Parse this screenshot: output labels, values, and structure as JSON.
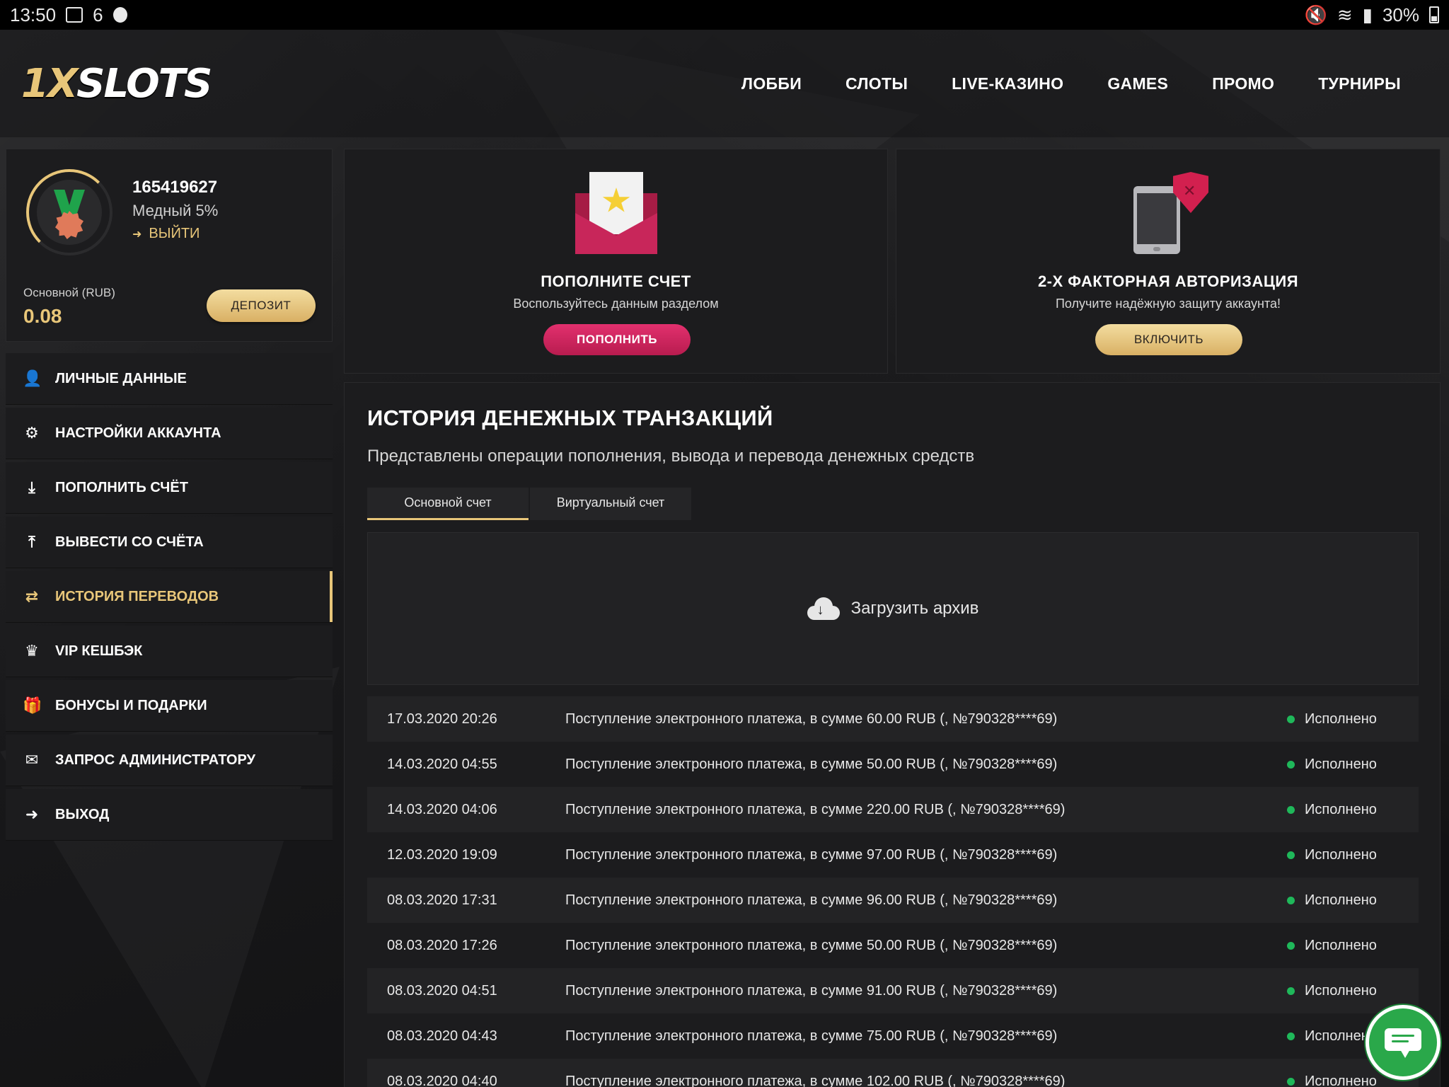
{
  "statusbar": {
    "time": "13:50",
    "notif_count": "6",
    "battery": "30%"
  },
  "header": {
    "logo_accent": "1X",
    "logo_main": "SLOTS",
    "nav": [
      "ЛОББИ",
      "СЛОТЫ",
      "LIVE-КАЗИНО",
      "GAMES",
      "ПРОМО",
      "ТУРНИРЫ"
    ]
  },
  "profile": {
    "user_id": "165419627",
    "level": "Медный 5%",
    "logout_label": "ВЫЙТИ",
    "balance_label": "Основной (RUB)",
    "balance_value": "0.08",
    "deposit_button": "ДЕПОЗИТ"
  },
  "menu": [
    {
      "label": "ЛИЧНЫЕ ДАННЫЕ",
      "icon": "user-plus-icon"
    },
    {
      "label": "НАСТРОЙКИ АККАУНТА",
      "icon": "gears-icon"
    },
    {
      "label": "ПОПОЛНИТЬ СЧЁТ",
      "icon": "download-icon"
    },
    {
      "label": "ВЫВЕСТИ СО СЧЁТА",
      "icon": "upload-icon"
    },
    {
      "label": "ИСТОРИЯ ПЕРЕВОДОВ",
      "icon": "transfer-arrows-icon",
      "active": true
    },
    {
      "label": "VIP КЕШБЭК",
      "icon": "crown-icon"
    },
    {
      "label": "БОНУСЫ И ПОДАРКИ",
      "icon": "gift-icon"
    },
    {
      "label": "ЗАПРОС АДМИНИСТРАТОРУ",
      "icon": "envelope-icon"
    },
    {
      "label": "ВЫХОД",
      "icon": "sign-out-icon"
    }
  ],
  "promo_deposit": {
    "title": "ПОПОЛНИТЕ СЧЕТ",
    "subtitle": "Воспользуйтесь данным разделом",
    "button": "ПОПОЛНИТЬ"
  },
  "promo_2fa": {
    "title": "2-Х ФАКТОРНАЯ АВТОРИЗАЦИЯ",
    "subtitle": "Получите надёжную защиту аккаунта!",
    "button": "ВКЛЮЧИТЬ"
  },
  "history": {
    "title": "ИСТОРИЯ ДЕНЕЖНЫХ ТРАНЗАКЦИЙ",
    "subtitle": "Представлены операции пополнения, вывода и перевода денежных средств",
    "tabs": [
      "Основной счет",
      "Виртуальный счет"
    ],
    "archive_label": "Загрузить архив",
    "rows": [
      {
        "date": "17.03.2020 20:26",
        "desc": "Поступление электронного платежа, в сумме 60.00 RUB (, №790328****69)",
        "status": "Исполнено"
      },
      {
        "date": "14.03.2020 04:55",
        "desc": "Поступление электронного платежа, в сумме 50.00 RUB (, №790328****69)",
        "status": "Исполнено"
      },
      {
        "date": "14.03.2020 04:06",
        "desc": "Поступление электронного платежа, в сумме 220.00 RUB (, №790328****69)",
        "status": "Исполнено"
      },
      {
        "date": "12.03.2020 19:09",
        "desc": "Поступление электронного платежа, в сумме 97.00 RUB (, №790328****69)",
        "status": "Исполнено"
      },
      {
        "date": "08.03.2020 17:31",
        "desc": "Поступление электронного платежа, в сумме 96.00 RUB (, №790328****69)",
        "status": "Исполнено"
      },
      {
        "date": "08.03.2020 17:26",
        "desc": "Поступление электронного платежа, в сумме 50.00 RUB (, №790328****69)",
        "status": "Исполнено"
      },
      {
        "date": "08.03.2020 04:51",
        "desc": "Поступление электронного платежа, в сумме 91.00 RUB (, №790328****69)",
        "status": "Исполнено"
      },
      {
        "date": "08.03.2020 04:43",
        "desc": "Поступление электронного платежа, в сумме 75.00 RUB (, №790328****69)",
        "status": "Исполнено"
      },
      {
        "date": "08.03.2020 04:40",
        "desc": "Поступление электронного платежа, в сумме 102.00 RUB (, №790328****69)",
        "status": "Исполнено"
      }
    ]
  },
  "colors": {
    "accent_gold": "#e8c679",
    "accent_pink": "#c8265a",
    "status_green": "#1fb85a",
    "chat_green": "#2aa84a"
  }
}
